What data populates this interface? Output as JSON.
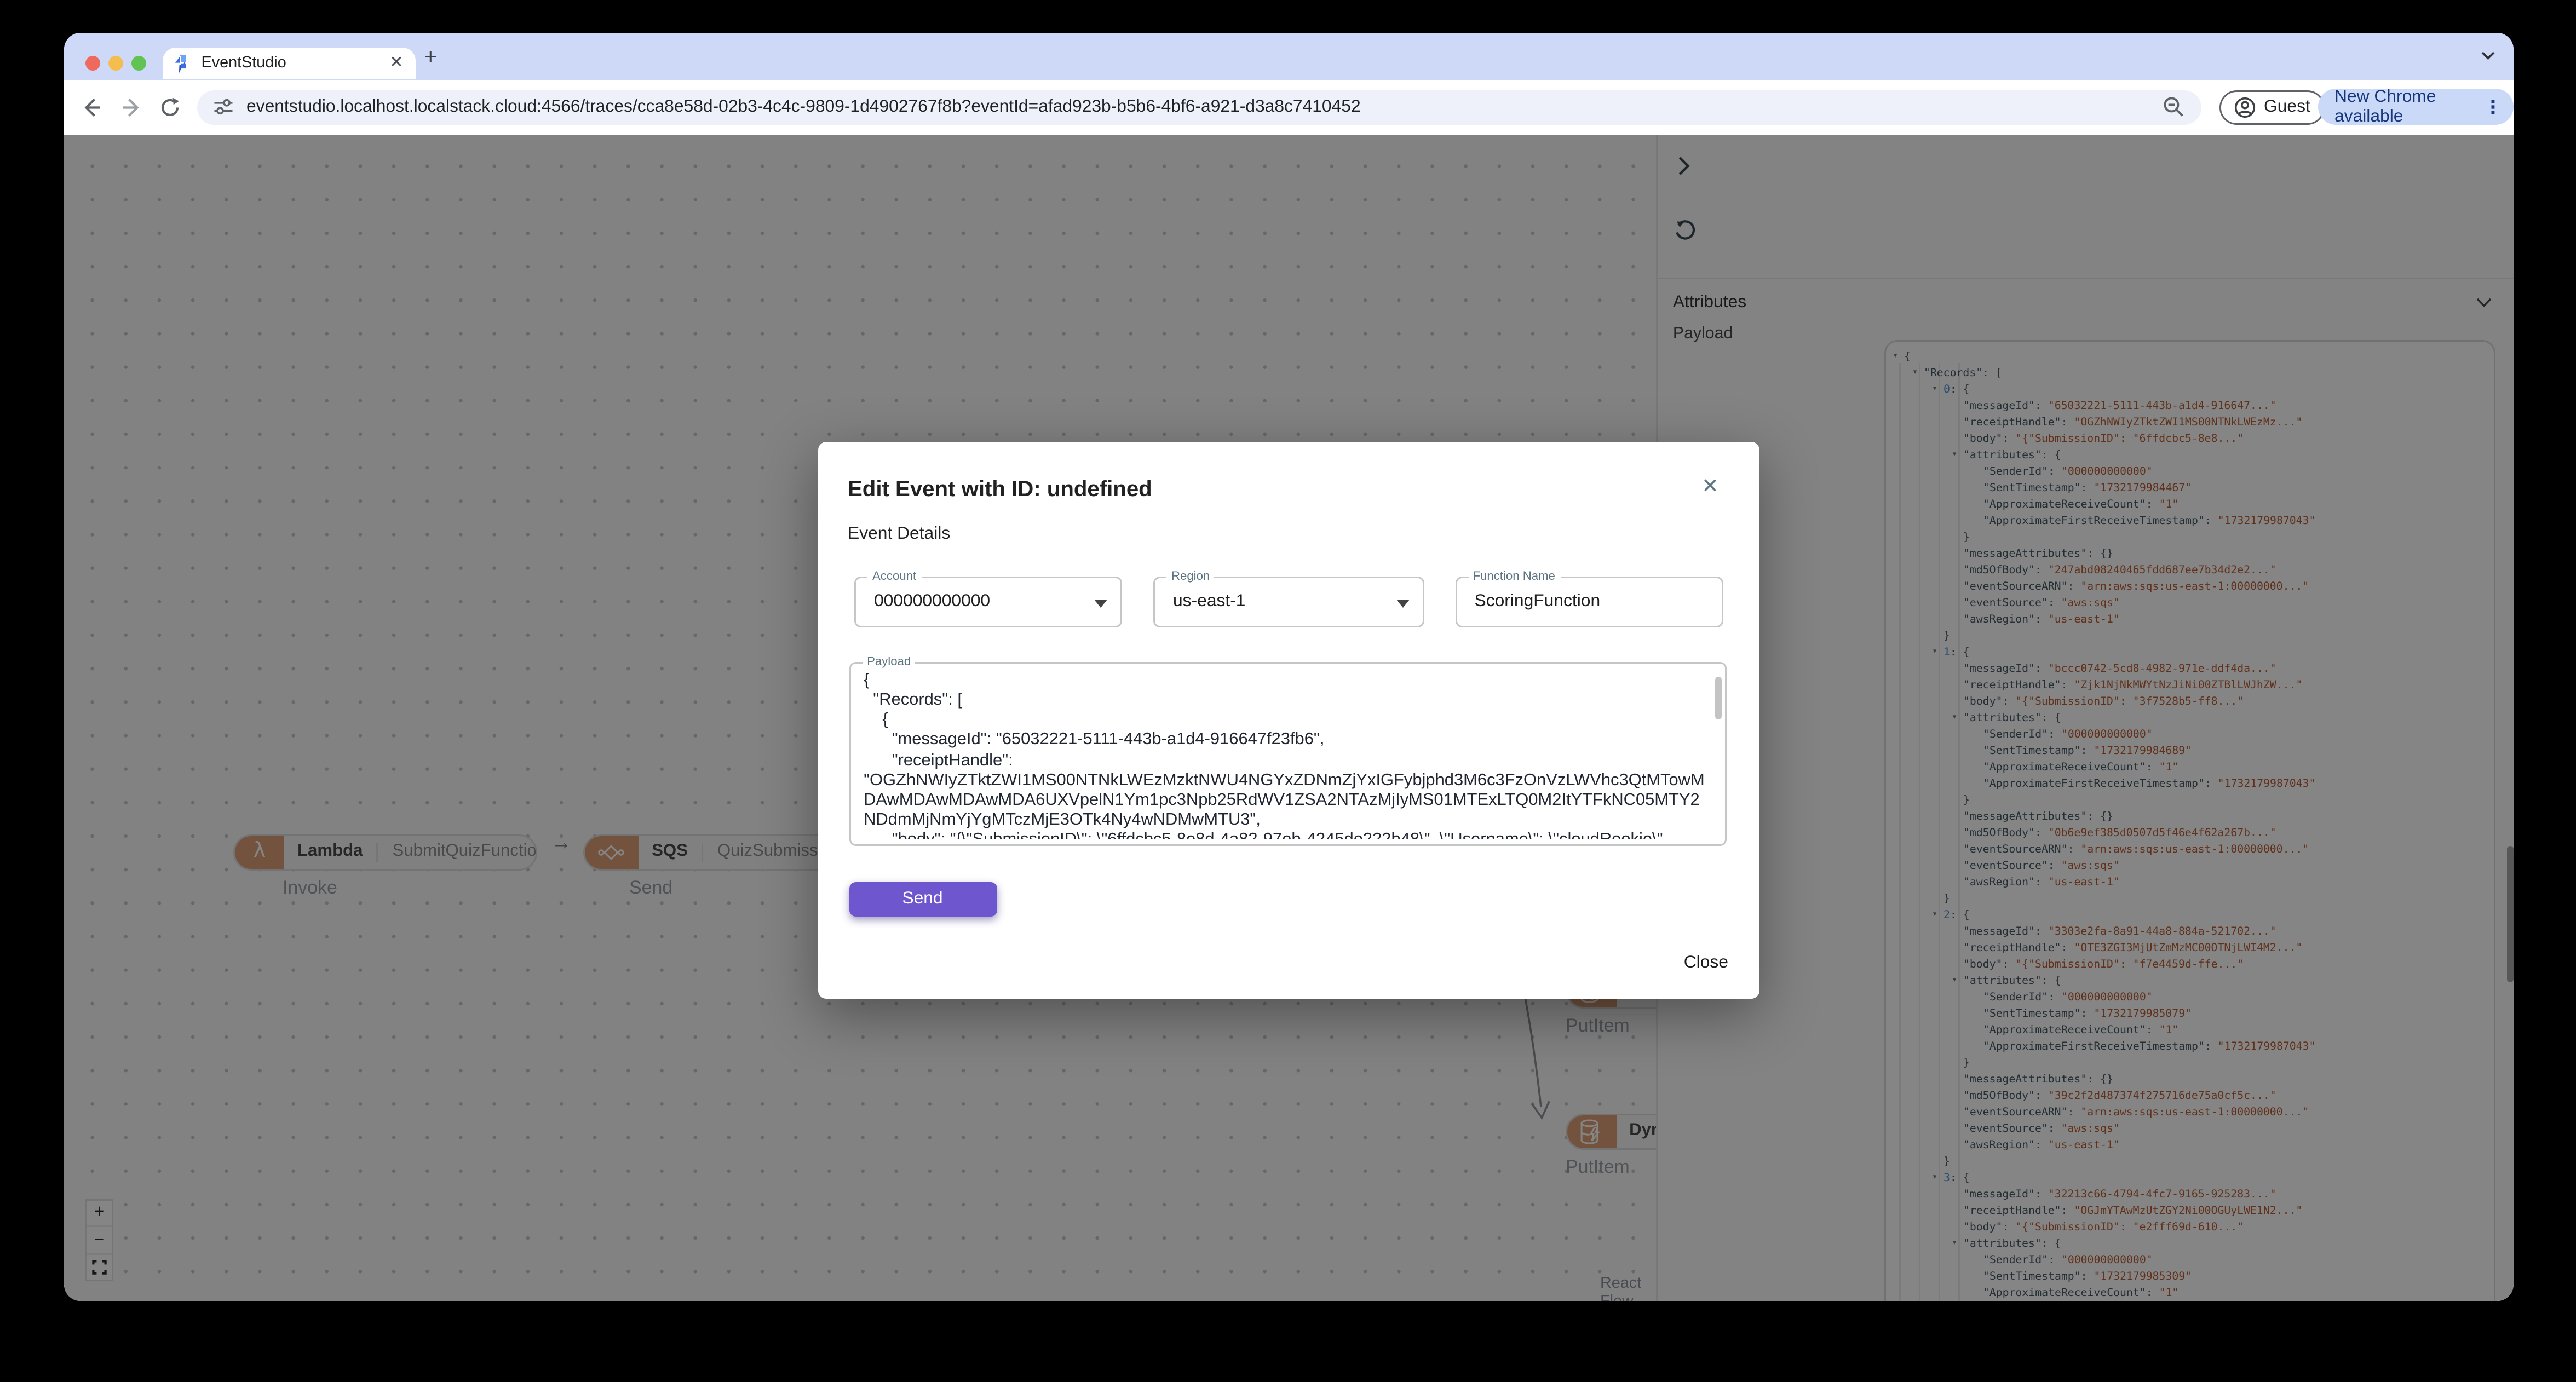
{
  "browser": {
    "tab_title": "EventStudio",
    "new_tab_label": "+",
    "tab_close_label": "✕",
    "url": "eventstudio.localhost.localstack.cloud:4566/traces/cca8e58d-02b3-4c4c-9809-1d4902767f8b?eventId=afad923b-b5b6-4bf6-a921-d3a8c7410452",
    "guest_label": "Guest",
    "update_label": "New Chrome available",
    "kebab_label": "⋮"
  },
  "canvas": {
    "nodes": [
      {
        "service": "Lambda",
        "name": "SubmitQuizFunction",
        "action": "Invoke"
      },
      {
        "service": "SQS",
        "name": "QuizSubmissionQueue",
        "action": "Send"
      },
      {
        "service": "DynamoDB",
        "name": "",
        "action": "PutItem"
      },
      {
        "service": "DynamoDB",
        "name": "",
        "action": "PutItem"
      }
    ],
    "edge_arrow": "→",
    "zoom_in_label": "+",
    "zoom_out_label": "−",
    "attribution": "React Flow"
  },
  "sidebar": {
    "attributes_label": "Attributes",
    "payload_label": "Payload",
    "json_lines": [
      {
        "l": 0,
        "c": 1,
        "t": "b",
        "k": "{"
      },
      {
        "l": 1,
        "c": 1,
        "t": "s",
        "k": "Records",
        "v": "[",
        "s": 0
      },
      {
        "l": 2,
        "c": 1,
        "t": "i",
        "k": "0",
        "v": "{",
        "s": 0
      },
      {
        "l": 3,
        "c": 0,
        "t": "s",
        "k": "messageId",
        "v": "\"65032221-5111-443b-a1d4-916647...\"",
        "s": 1
      },
      {
        "l": 3,
        "c": 0,
        "t": "s",
        "k": "receiptHandle",
        "v": "\"OGZhNWIyZTktZWI1MS00NTNkLWEzMz...\"",
        "s": 1
      },
      {
        "l": 3,
        "c": 0,
        "t": "s",
        "k": "body",
        "v": "\"{\"SubmissionID\": \"6ffdcbc5-8e8...\"",
        "s": 1
      },
      {
        "l": 3,
        "c": 1,
        "t": "s",
        "k": "attributes",
        "v": "{",
        "s": 0
      },
      {
        "l": 4,
        "c": 0,
        "t": "s",
        "k": "SenderId",
        "v": "\"000000000000\"",
        "s": 1
      },
      {
        "l": 4,
        "c": 0,
        "t": "s",
        "k": "SentTimestamp",
        "v": "\"1732179984467\"",
        "s": 1
      },
      {
        "l": 4,
        "c": 0,
        "t": "s",
        "k": "ApproximateReceiveCount",
        "v": "\"1\"",
        "s": 1
      },
      {
        "l": 4,
        "c": 0,
        "t": "s",
        "k": "ApproximateFirstReceiveTimestamp",
        "v": "\"1732179987043\"",
        "s": 1
      },
      {
        "l": 3,
        "c": 0,
        "t": "b",
        "k": "}"
      },
      {
        "l": 3,
        "c": 0,
        "t": "s",
        "k": "messageAttributes",
        "v": "{}",
        "s": 0
      },
      {
        "l": 3,
        "c": 0,
        "t": "s",
        "k": "md5OfBody",
        "v": "\"247abd08240465fdd687ee7b34d2e2...\"",
        "s": 1
      },
      {
        "l": 3,
        "c": 0,
        "t": "s",
        "k": "eventSourceARN",
        "v": "\"arn:aws:sqs:us-east-1:00000000...\"",
        "s": 1
      },
      {
        "l": 3,
        "c": 0,
        "t": "s",
        "k": "eventSource",
        "v": "\"aws:sqs\"",
        "s": 1
      },
      {
        "l": 3,
        "c": 0,
        "t": "s",
        "k": "awsRegion",
        "v": "\"us-east-1\"",
        "s": 1
      },
      {
        "l": 2,
        "c": 0,
        "t": "b",
        "k": "}"
      },
      {
        "l": 2,
        "c": 1,
        "t": "i",
        "k": "1",
        "v": "{",
        "s": 0
      },
      {
        "l": 3,
        "c": 0,
        "t": "s",
        "k": "messageId",
        "v": "\"bccc0742-5cd8-4982-971e-ddf4da...\"",
        "s": 1
      },
      {
        "l": 3,
        "c": 0,
        "t": "s",
        "k": "receiptHandle",
        "v": "\"Zjk1NjNkMWYtNzJiNi00ZTBlLWJhZW...\"",
        "s": 1
      },
      {
        "l": 3,
        "c": 0,
        "t": "s",
        "k": "body",
        "v": "\"{\"SubmissionID\": \"3f7528b5-ff8...\"",
        "s": 1
      },
      {
        "l": 3,
        "c": 1,
        "t": "s",
        "k": "attributes",
        "v": "{",
        "s": 0
      },
      {
        "l": 4,
        "c": 0,
        "t": "s",
        "k": "SenderId",
        "v": "\"000000000000\"",
        "s": 1
      },
      {
        "l": 4,
        "c": 0,
        "t": "s",
        "k": "SentTimestamp",
        "v": "\"1732179984689\"",
        "s": 1
      },
      {
        "l": 4,
        "c": 0,
        "t": "s",
        "k": "ApproximateReceiveCount",
        "v": "\"1\"",
        "s": 1
      },
      {
        "l": 4,
        "c": 0,
        "t": "s",
        "k": "ApproximateFirstReceiveTimestamp",
        "v": "\"1732179987043\"",
        "s": 1
      },
      {
        "l": 3,
        "c": 0,
        "t": "b",
        "k": "}"
      },
      {
        "l": 3,
        "c": 0,
        "t": "s",
        "k": "messageAttributes",
        "v": "{}",
        "s": 0
      },
      {
        "l": 3,
        "c": 0,
        "t": "s",
        "k": "md5OfBody",
        "v": "\"0b6e9ef385d0507d5f46e4f62a267b...\"",
        "s": 1
      },
      {
        "l": 3,
        "c": 0,
        "t": "s",
        "k": "eventSourceARN",
        "v": "\"arn:aws:sqs:us-east-1:00000000...\"",
        "s": 1
      },
      {
        "l": 3,
        "c": 0,
        "t": "s",
        "k": "eventSource",
        "v": "\"aws:sqs\"",
        "s": 1
      },
      {
        "l": 3,
        "c": 0,
        "t": "s",
        "k": "awsRegion",
        "v": "\"us-east-1\"",
        "s": 1
      },
      {
        "l": 2,
        "c": 0,
        "t": "b",
        "k": "}"
      },
      {
        "l": 2,
        "c": 1,
        "t": "i",
        "k": "2",
        "v": "{",
        "s": 0
      },
      {
        "l": 3,
        "c": 0,
        "t": "s",
        "k": "messageId",
        "v": "\"3303e2fa-8a91-44a8-884a-521702...\"",
        "s": 1
      },
      {
        "l": 3,
        "c": 0,
        "t": "s",
        "k": "receiptHandle",
        "v": "\"OTE3ZGI3MjUtZmMzMC00OTNjLWI4M2...\"",
        "s": 1
      },
      {
        "l": 3,
        "c": 0,
        "t": "s",
        "k": "body",
        "v": "\"{\"SubmissionID\": \"f7e4459d-ffe...\"",
        "s": 1
      },
      {
        "l": 3,
        "c": 1,
        "t": "s",
        "k": "attributes",
        "v": "{",
        "s": 0
      },
      {
        "l": 4,
        "c": 0,
        "t": "s",
        "k": "SenderId",
        "v": "\"000000000000\"",
        "s": 1
      },
      {
        "l": 4,
        "c": 0,
        "t": "s",
        "k": "SentTimestamp",
        "v": "\"1732179985079\"",
        "s": 1
      },
      {
        "l": 4,
        "c": 0,
        "t": "s",
        "k": "ApproximateReceiveCount",
        "v": "\"1\"",
        "s": 1
      },
      {
        "l": 4,
        "c": 0,
        "t": "s",
        "k": "ApproximateFirstReceiveTimestamp",
        "v": "\"1732179987043\"",
        "s": 1
      },
      {
        "l": 3,
        "c": 0,
        "t": "b",
        "k": "}"
      },
      {
        "l": 3,
        "c": 0,
        "t": "s",
        "k": "messageAttributes",
        "v": "{}",
        "s": 0
      },
      {
        "l": 3,
        "c": 0,
        "t": "s",
        "k": "md5OfBody",
        "v": "\"39c2f2d487374f275716de75a0cf5c...\"",
        "s": 1
      },
      {
        "l": 3,
        "c": 0,
        "t": "s",
        "k": "eventSourceARN",
        "v": "\"arn:aws:sqs:us-east-1:00000000...\"",
        "s": 1
      },
      {
        "l": 3,
        "c": 0,
        "t": "s",
        "k": "eventSource",
        "v": "\"aws:sqs\"",
        "s": 1
      },
      {
        "l": 3,
        "c": 0,
        "t": "s",
        "k": "awsRegion",
        "v": "\"us-east-1\"",
        "s": 1
      },
      {
        "l": 2,
        "c": 0,
        "t": "b",
        "k": "}"
      },
      {
        "l": 2,
        "c": 1,
        "t": "i",
        "k": "3",
        "v": "{",
        "s": 0
      },
      {
        "l": 3,
        "c": 0,
        "t": "s",
        "k": "messageId",
        "v": "\"32213c66-4794-4fc7-9165-925283...\"",
        "s": 1
      },
      {
        "l": 3,
        "c": 0,
        "t": "s",
        "k": "receiptHandle",
        "v": "\"OGJmYTAwMzUtZGY2Ni00OGUyLWE1N2...\"",
        "s": 1
      },
      {
        "l": 3,
        "c": 0,
        "t": "s",
        "k": "body",
        "v": "\"{\"SubmissionID\": \"e2fff69d-610...\"",
        "s": 1
      },
      {
        "l": 3,
        "c": 1,
        "t": "s",
        "k": "attributes",
        "v": "{",
        "s": 0
      },
      {
        "l": 4,
        "c": 0,
        "t": "s",
        "k": "SenderId",
        "v": "\"000000000000\"",
        "s": 1
      },
      {
        "l": 4,
        "c": 0,
        "t": "s",
        "k": "SentTimestamp",
        "v": "\"1732179985309\"",
        "s": 1
      },
      {
        "l": 4,
        "c": 0,
        "t": "s",
        "k": "ApproximateReceiveCount",
        "v": "\"1\"",
        "s": 1
      }
    ]
  },
  "modal": {
    "title": "Edit Event with ID: undefined",
    "close_icon_label": "✕",
    "section_label": "Event Details",
    "fields": {
      "account": {
        "label": "Account",
        "value": "000000000000"
      },
      "region": {
        "label": "Region",
        "value": "us-east-1"
      },
      "function_name": {
        "label": "Function Name",
        "value": "ScoringFunction"
      }
    },
    "payload": {
      "label": "Payload",
      "value": "{\n  \"Records\": [\n    {\n      \"messageId\": \"65032221-5111-443b-a1d4-916647f23fb6\",\n      \"receiptHandle\": \"OGZhNWIyZTktZWI1MS00NTNkLWEzMzktNWU4NGYxZDNmZjYxIGFybjphd3M6c3FzOnVzLWVhc3QtMTowMDAwMDAwMDAwMDA6UXVpelN1Ym1pc3Npb25RdWV1ZSA2NTAzMjIyMS01MTExLTQ0M2ItYTFkNC05MTY2NDdmMjNmYjYgMTczMjE3OTk4Ny4wNDMwMTU3\",\n      \"body\": \"{\\\"SubmissionID\\\": \\\"6ffdcbc5-8e8d-4a82-97eb-4245de222b48\\\", \\\"Username\\\": \\\"cloudRookie\\\", \\\"QuizID\\\": \\\"adorable-"
    },
    "send_label": "Send",
    "close_label": "Close"
  },
  "colors": {
    "accent": "#6e56cf",
    "aws_icon_bg": "#dd9f78",
    "tab_strip_bg": "#cdd9f6",
    "update_pill_bg": "#cbd9f8",
    "update_pill_text": "#16377c",
    "json_key": "#455a64",
    "json_string": "#bb5f35",
    "json_index": "#4a90d9",
    "traffic_red": "#ee6a5f",
    "traffic_yellow": "#f5bd4f",
    "traffic_green": "#61c354"
  }
}
